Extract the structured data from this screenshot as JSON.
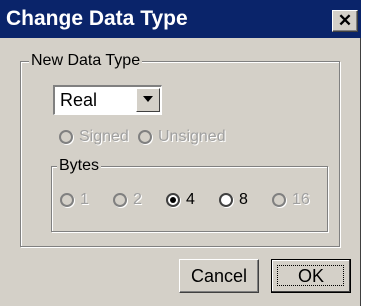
{
  "window": {
    "title": "Change Data Type",
    "close_icon": "close-icon",
    "close_symbol": "✕"
  },
  "data_type_group": {
    "label": "New Data Type",
    "selected": "Real",
    "dropdown_icon": "chevron-down-icon"
  },
  "sign": {
    "signed_label": "Signed",
    "unsigned_label": "Unsigned",
    "enabled": false
  },
  "bytes_group": {
    "label": "Bytes",
    "options": [
      "1",
      "2",
      "4",
      "8",
      "16"
    ],
    "selected": "4"
  },
  "buttons": {
    "cancel_label": "Cancel",
    "ok_label": "OK"
  },
  "colors": {
    "titlebar": "#0a246a",
    "face": "#d4d0c8",
    "disabled_text": "#a0a0a0"
  }
}
